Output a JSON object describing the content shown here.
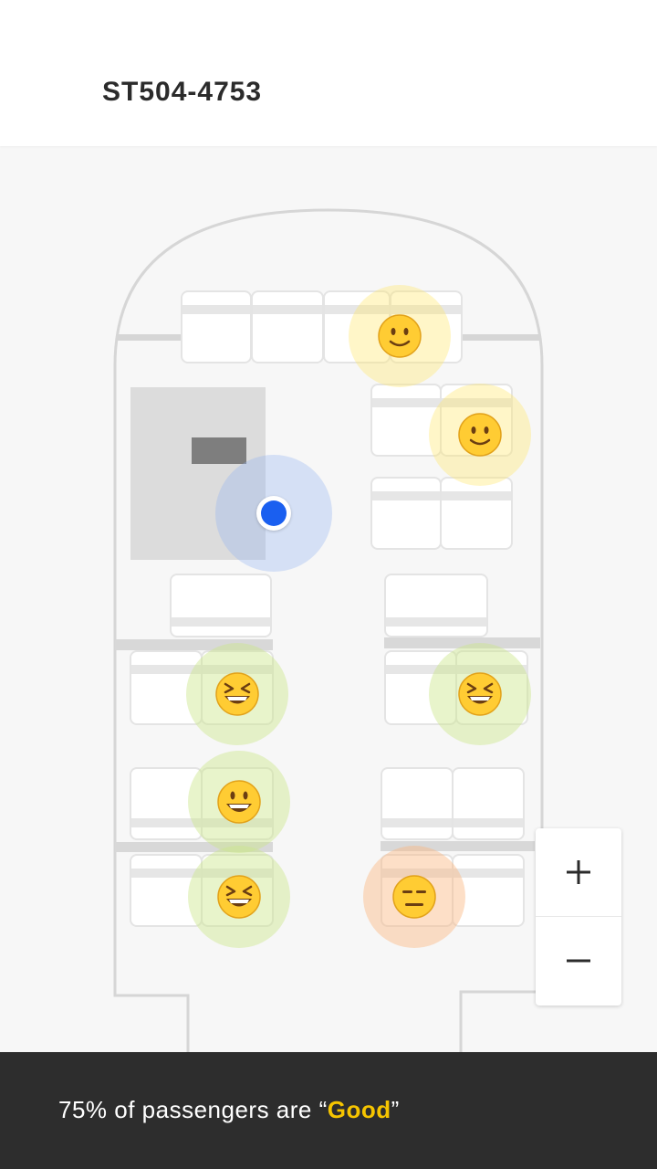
{
  "header": {
    "flight_code": "ST504-4753"
  },
  "map": {
    "colors": {
      "accent": "#1a5ff0",
      "good": "#f5c400",
      "fuselage": "#d6d6d6",
      "lavatory": "#dcdcdc"
    },
    "passengers": [
      {
        "mood": "slightly-smiling-face-icon",
        "tone": "yellow"
      },
      {
        "mood": "slightly-smiling-face-icon",
        "tone": "yellow"
      },
      {
        "mood": "grinning-squinting-face-icon",
        "tone": "green"
      },
      {
        "mood": "grinning-squinting-face-icon",
        "tone": "green"
      },
      {
        "mood": "grinning-face-icon",
        "tone": "green"
      },
      {
        "mood": "grinning-squinting-face-icon",
        "tone": "green"
      },
      {
        "mood": "expressionless-face-icon",
        "tone": "orange"
      }
    ]
  },
  "zoom": {
    "in_symbol": "+",
    "out_symbol": "−"
  },
  "footer": {
    "prefix": "75% of passengers are “",
    "highlight": "Good",
    "suffix": "”"
  }
}
